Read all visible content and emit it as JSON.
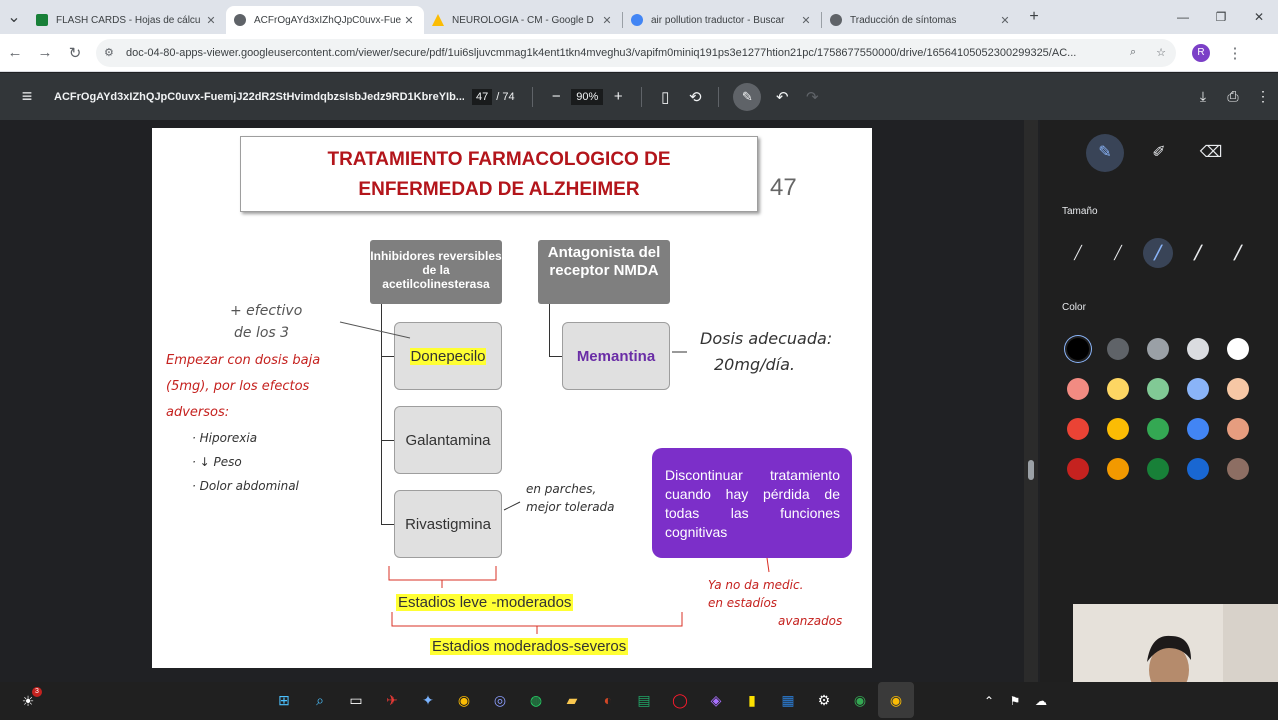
{
  "tabs": [
    {
      "title": "FLASH CARDS - Hojas de cálcu",
      "color": "#188038",
      "active": false
    },
    {
      "title": "ACFrOgAYd3xIZhQJpC0uvx-Fue",
      "color": "#5f6368",
      "active": true
    },
    {
      "title": "NEUROLOGIA - CM - Google D",
      "color": "#fbbc04",
      "active": false
    },
    {
      "title": "air pollution traductor - Buscar",
      "color": "#4285f4",
      "active": false
    },
    {
      "title": "Traducción de síntomas",
      "color": "#5f6368",
      "active": false
    }
  ],
  "address": {
    "url": "doc-04-80-apps-viewer.googleusercontent.com/viewer/secure/pdf/1ui6sljuvcmmag1k4ent1tkn4mveghu3/vapifm0miniq191ps3e1277htion21pc/1758677550000/drive/16564105052300299325/AC...",
    "profile_initial": "R"
  },
  "pdf_toolbar": {
    "filename": "ACFrOgAYd3xIZhQJpC0uvx-FuemjJ22dR2StHvimdqbzsIsbJedz9RD1KbreYIb...",
    "current_page": "47",
    "total_pages": "/ 74",
    "zoom": "90%"
  },
  "slide": {
    "title_line1": "TRATAMIENTO FARMACOLOGICO DE",
    "title_line2": "ENFERMEDAD DE ALZHEIMER",
    "page_number": "47",
    "header1": "Inhibidores reversibles de la acetilcolinesterasa",
    "header2": "Antagonista del receptor NMDA",
    "drug1": "Donepecilo",
    "drug2": "Galantamina",
    "drug3": "Rivastigmina",
    "drug4": "Memantina",
    "purple_text": "Discontinuar tratamiento cuando hay pérdida de todas las funciones cognitivas",
    "stage1": "Estadios leve -moderados",
    "stage2": "Estadios moderados-severos"
  },
  "handwriting": {
    "note1_l1": "+ efectivo",
    "note1_l2": "de los 3",
    "note2_l1": "Empezar con dosis baja",
    "note2_l2": "(5mg), por los efectos",
    "note2_l3": "adversos:",
    "note2_l4": "· Hiporexia",
    "note2_l5": "· ↓ Peso",
    "note2_l6": "· Dolor abdominal",
    "note3_l1": "Dosis adecuada:",
    "note3_l2": "20mg/día.",
    "note4_l1": "en parches,",
    "note4_l2": "mejor tolerada",
    "note5_l1": "Ya no da medic.",
    "note5_l2": "en estadíos",
    "note5_l3": "avanzados"
  },
  "side_panel": {
    "size_label": "Tamaño",
    "color_label": "Color",
    "colors": [
      "#000000",
      "#5f6368",
      "#9aa0a6",
      "#dadce0",
      "#ffffff",
      "#f28b82",
      "#fdd663",
      "#81c995",
      "#8ab4f8",
      "#f6c7a5",
      "#ea4335",
      "#fbbc04",
      "#34a853",
      "#4285f4",
      "#e69d7f",
      "#c5221f",
      "#f29900",
      "#188038",
      "#1967d2",
      "#8d6e63"
    ]
  },
  "taskbar": {
    "badge": "3"
  }
}
